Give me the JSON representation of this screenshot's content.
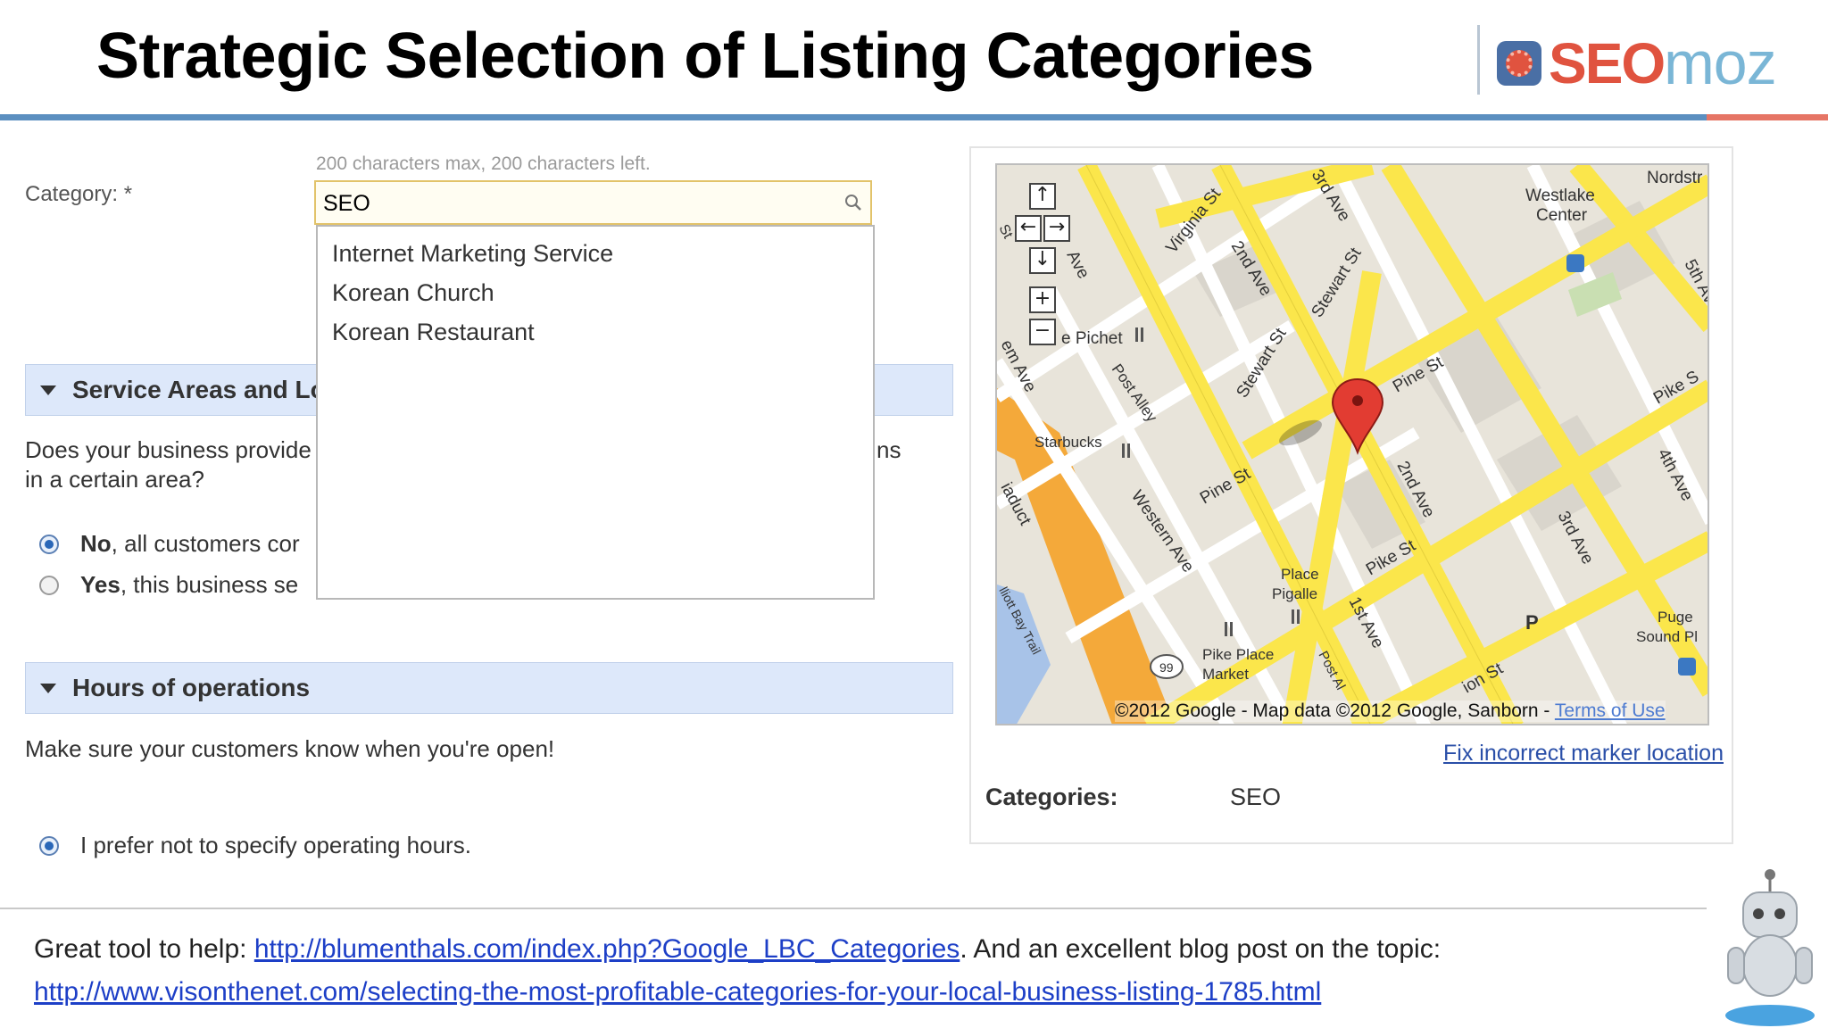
{
  "slide": {
    "title": "Strategic Selection of Listing Categories",
    "logo": {
      "part1": "SEO",
      "part2": "moz"
    }
  },
  "form": {
    "char_hint": "200 characters max, 200 characters left.",
    "category_label": "Category: *",
    "category_value": "SEO",
    "suggestions": [
      "Internet Marketing Service",
      "Korean Church",
      "Korean Restaurant"
    ],
    "service_areas": {
      "heading": "Service Areas and Lo",
      "question_line1": "Does your business provide",
      "question_line1_end": "ns",
      "question_line2": "in a certain area?",
      "option_no_bold": "No",
      "option_no_rest": ", all customers cor",
      "option_yes_bold": "Yes",
      "option_yes_rest": ", this business se",
      "selected": "No"
    },
    "hours": {
      "heading": "Hours of operations",
      "description": "Make sure your customers know when you're open!",
      "option": "I prefer not to specify operating hours.",
      "selected": true
    }
  },
  "map": {
    "labels": {
      "virginia": "Virginia St",
      "third_ave_top": "3rd Ave",
      "westlake": "Westlake",
      "center": "Center",
      "nordstrom": "Nordstr",
      "second_ave_top": "2nd Ave",
      "stewart_top": "Stewart St",
      "fifth_ave": "5th Av",
      "first_ave_top": "Ave",
      "pichet": "e Pichet",
      "stewart_mid": "Stewart St",
      "pine_top": "Pine St",
      "pike_right": "Pike S",
      "post_alley": "Post Alley",
      "starbucks": "Starbucks",
      "elliott": "em Ave",
      "pine_mid": "Pine St",
      "second_ave_mid": "2nd Ave",
      "fourth_ave": "4th Ave",
      "third_ave_mid": "3rd Ave",
      "western": "Western Ave",
      "viaduct": "iaduct",
      "place": "Place",
      "pigalle": "Pigalle",
      "pike_mid": "Pike St",
      "bay_trail": "lliott Bay Trail",
      "first_ave_bottom": "1st Ave",
      "pike_place": "Pike Place",
      "market": "Market",
      "union": "ion St",
      "post_ave": "Post Al",
      "puget": "Puge",
      "sound": "Sound Pl",
      "route": "99",
      "parking": "P",
      "left_edge": "St"
    },
    "copyright": "©2012 Google - Map data ©2012 Google, Sanborn - ",
    "terms": "Terms of Use",
    "fix_link": "Fix incorrect marker location",
    "categories_label": "Categories:",
    "categories_value": "SEO"
  },
  "footer": {
    "line1_prefix": "Great tool to help: ",
    "link1": "http://blumenthals.com/index.php?Google_LBC_Categories",
    "line1_suffix": ". And an excellent blog post on the topic:",
    "link2": "http://www.visonthenet.com/selecting-the-most-profitable-categories-for-your-local-business-listing-1785.html"
  },
  "colors": {
    "header_rule": "#5b8fc0",
    "accent_red": "#e0533f",
    "section_bar": "#dde8fa",
    "road_yellow": "#fbe64b",
    "highway_orange": "#f4a93a",
    "link_blue": "#1d3fc7"
  }
}
